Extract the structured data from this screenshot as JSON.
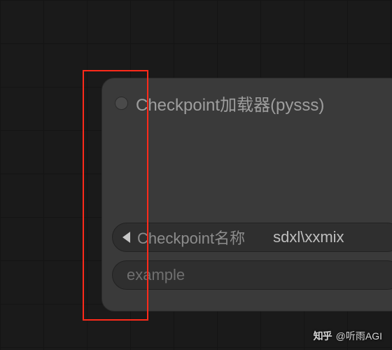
{
  "node": {
    "title": "Checkpoint加载器(pysss)",
    "checkpoint_combo": {
      "label": "Checkpoint名称",
      "value": "sdxl\\xxmix"
    },
    "text_widget": {
      "placeholder": "example"
    }
  },
  "watermark": {
    "logo": "知乎",
    "text": "@听雨AGI"
  }
}
